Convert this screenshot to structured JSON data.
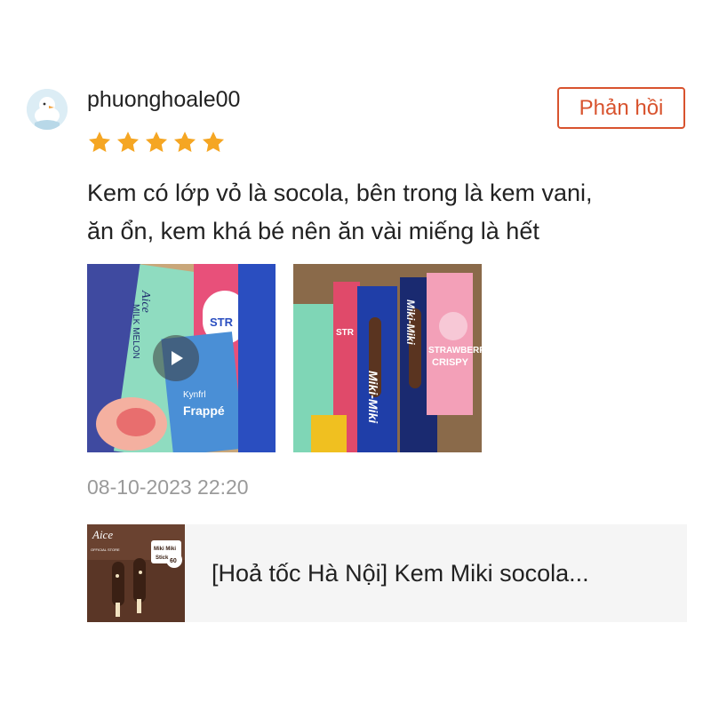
{
  "review": {
    "username": "phuonghoale00",
    "rating": 5,
    "reply_label": "Phản hồi",
    "text_line1": "Kem có lớp vỏ là socola, bên trong là kem vani,",
    "text_line2": "ăn ổn, kem khá bé nên ăn vài miếng là hết",
    "timestamp": "08-10-2023 22:20"
  },
  "media": {
    "video_labels": [
      "Aice",
      "MILK MELON",
      "STR",
      "Kynfrl",
      "Frappé"
    ],
    "photo_labels": [
      "Miki-Miki",
      "Miki-Miki",
      "STRAWBERR",
      "CRISPY",
      "STR"
    ]
  },
  "product": {
    "title": "[Hoả tốc Hà Nội] Kem Miki socola...",
    "thumb_labels": [
      "Aice",
      "Miki Miki",
      "Stick",
      "60",
      "OFFICIAL STORE"
    ]
  },
  "colors": {
    "accent": "#d8532e",
    "star": "#f5a623",
    "muted": "#9a9a9a"
  }
}
